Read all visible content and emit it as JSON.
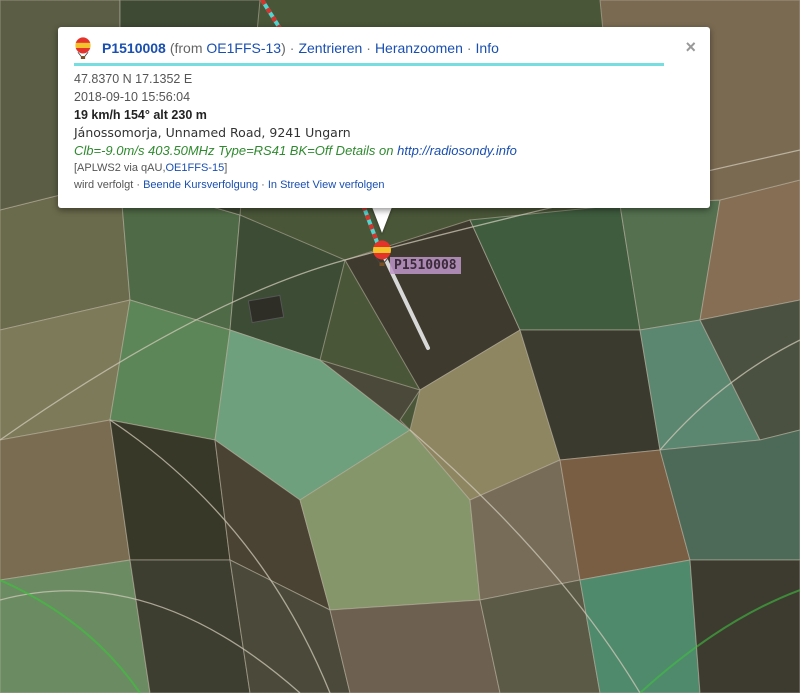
{
  "popup": {
    "callsign": "P1510008",
    "from_prefix": "(from ",
    "from_station": "OE1FFS-13",
    "from_suffix": ")",
    "links": [
      "Zentrieren",
      "Heranzoomen",
      "Info"
    ],
    "close": "×",
    "coords": "47.8370 N 17.1352 E",
    "timestamp": "2018-09-10 15:56:04",
    "speed_alt": "19 km/h 154° alt 230 m",
    "address": "Jánossomorja, Unnamed Road, 9241 Ungarn",
    "comment_text": "Clb=-9.0m/s 403.50MHz Type=RS41 BK=Off Details on ",
    "comment_link": "http://radiosondy.info",
    "path_prefix": "[APLWS2 via qAU,",
    "path_station": "OE1FFS-15",
    "path_suffix": "]",
    "tracking_status": "wird verfolgt",
    "tracking_actions": [
      "Beende Kursverfolgung",
      "In Street View verfolgen"
    ]
  },
  "marker": {
    "label": "P1510008",
    "icon": "balloon-icon"
  },
  "colors": {
    "track_red": "#d8322a",
    "track_cyan": "#4fd6d0",
    "accent": "#76dde0",
    "link": "#1a4fb0",
    "comment": "#2f8a2f"
  }
}
